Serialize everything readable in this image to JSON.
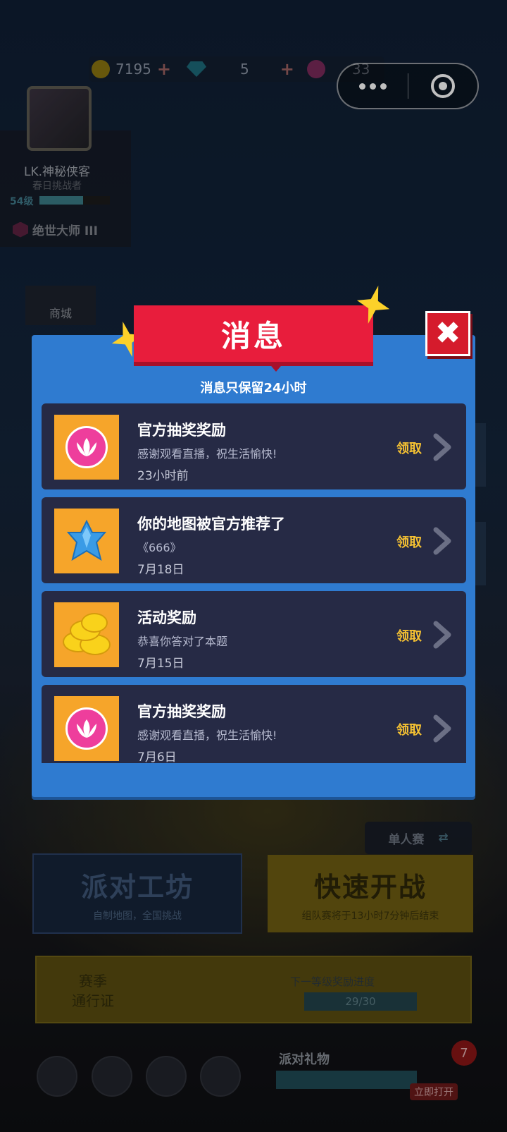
{
  "top_bar": {
    "coins": "7195",
    "gems": "5",
    "tokens": "33"
  },
  "profile": {
    "name": "LK.神秘侠客",
    "title": "春日挑战者",
    "level": "54级",
    "level_progress": 0.62,
    "rank": "绝世大师 III"
  },
  "shop": {
    "label": "商城"
  },
  "modal": {
    "title": "消息",
    "notice": "消息只保留24小时",
    "messages": [
      {
        "icon": "lotus-icon",
        "title": "官方抽奖奖励",
        "subtitle": "感谢观看直播，祝生活愉快!",
        "time": "23小时前",
        "action": "领取"
      },
      {
        "icon": "crystal-star-icon",
        "title": "你的地图被官方推荐了",
        "subtitle": "《666》",
        "time": "7月18日",
        "action": "领取"
      },
      {
        "icon": "gold-coins-icon",
        "title": "活动奖励",
        "subtitle": "恭喜你答对了本题",
        "time": "7月15日",
        "action": "领取"
      },
      {
        "icon": "lotus-icon",
        "title": "官方抽奖奖励",
        "subtitle": "感谢观看直播，祝生活愉快!",
        "time": "7月6日",
        "action": "领取"
      }
    ]
  },
  "bottom": {
    "single_mode": "单人赛",
    "workshop_title": "派对工坊",
    "workshop_sub": "自制地图，全国挑战",
    "quick_title": "快速开战",
    "quick_sub": "组队赛将于13小时7分钟后结束",
    "season_pass": "赛季\n通行证",
    "season_next": "下一等级奖励进度",
    "season_progress": "29/30",
    "gift_label": "派对礼物",
    "gift_open": "立即打开",
    "gift_count": "7"
  },
  "colors": {
    "modal_blue": "#2f7bd0",
    "ribbon_red": "#e81d3c",
    "claim_yellow": "#f6c232",
    "row_dark": "#262a45",
    "tile_orange": "#f6a52a"
  }
}
